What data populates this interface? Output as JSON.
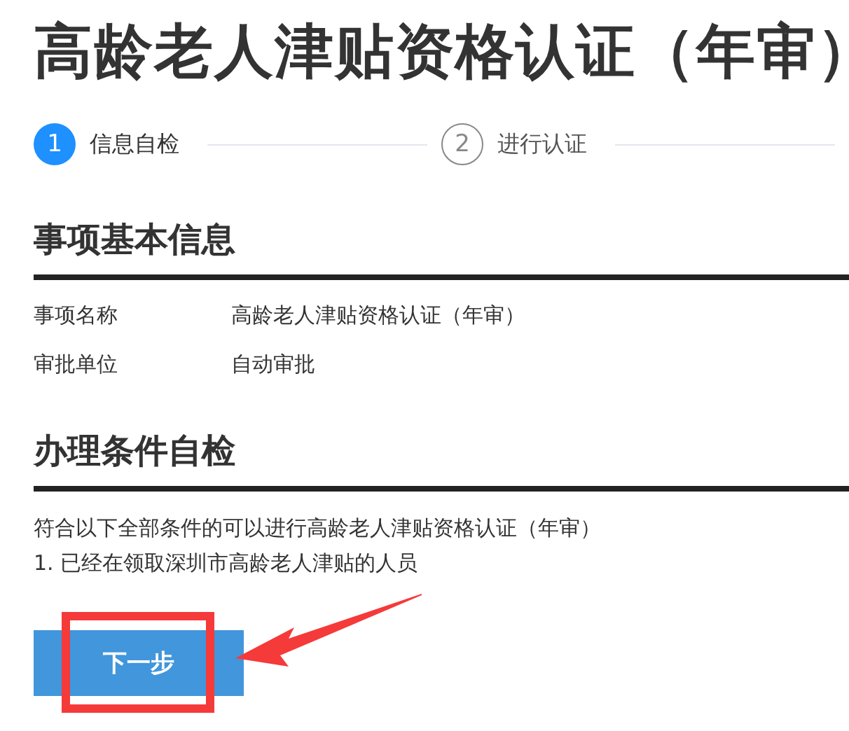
{
  "title": "高龄老人津贴资格认证（年审）",
  "steps": [
    {
      "number": "1",
      "label": "信息自检",
      "selected": true
    },
    {
      "number": "2",
      "label": "进行认证",
      "selected": false
    }
  ],
  "basic_info": {
    "heading": "事项基本信息",
    "rows": [
      {
        "label": "事项名称",
        "value": "高龄老人津贴资格认证（年审）"
      },
      {
        "label": "审批单位",
        "value": "自动审批"
      }
    ]
  },
  "self_check": {
    "heading": "办理条件自检",
    "intro": "符合以下全部条件的可以进行高龄老人津贴资格认证（年审）",
    "conditions": [
      "1. 已经在领取深圳市高龄老人津贴的人员"
    ]
  },
  "next_button": {
    "label": "下一步"
  },
  "annotation": {
    "highlight": true,
    "arrow": true
  }
}
